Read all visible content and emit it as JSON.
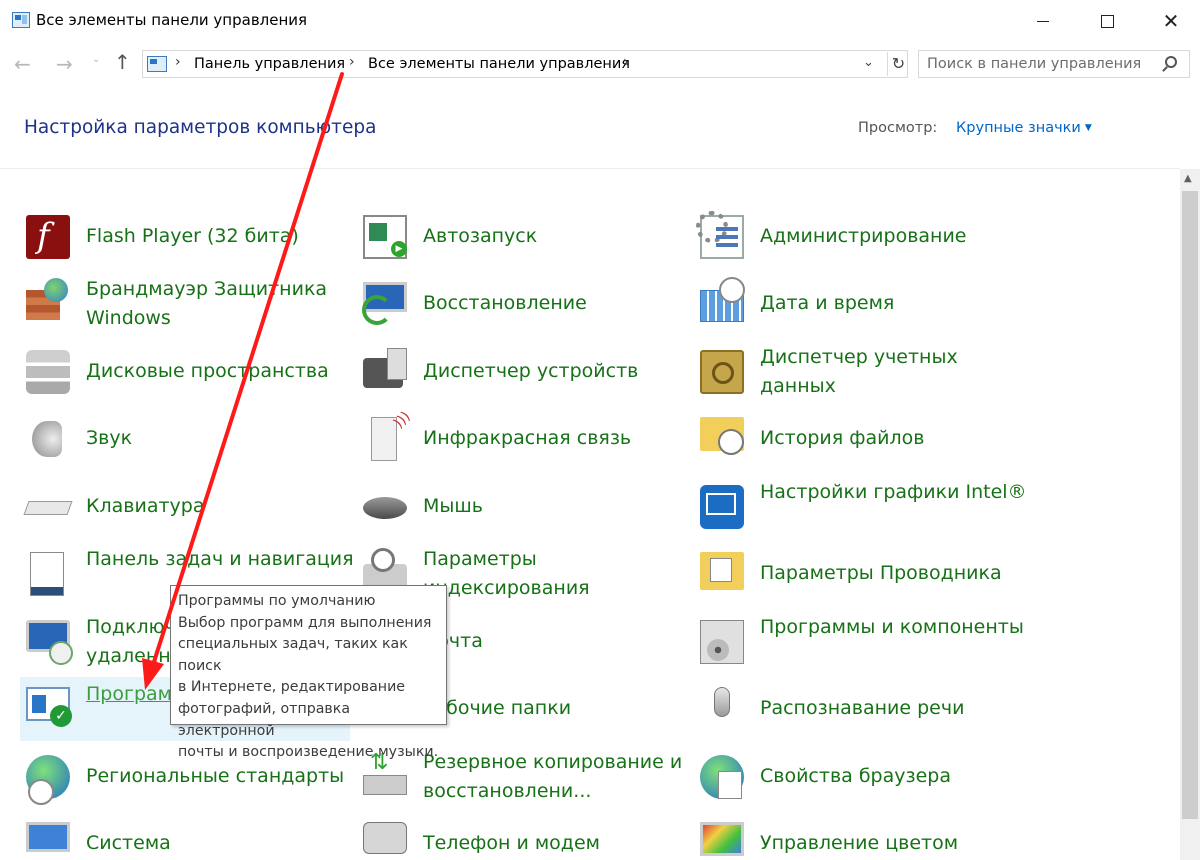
{
  "window": {
    "title": "Все элементы панели управления",
    "minimize": "",
    "maximize": "",
    "close": "✕"
  },
  "nav": {
    "back": "←",
    "forward": "→",
    "recent": "⌄",
    "up": "↑",
    "breadcrumbs": [
      "Панель управления",
      "Все элементы панели управления"
    ],
    "separator": "›",
    "dropdown": "⌄",
    "refresh": "↻"
  },
  "search": {
    "placeholder": "Поиск в панели управления"
  },
  "header": {
    "title": "Настройка параметров компьютера",
    "view_label": "Просмотр:",
    "view_value": "Крупные значки",
    "view_chevron": "▼"
  },
  "columns": [
    [
      {
        "label": "Flash Player (32 бита)",
        "icon": "flash-player-icon"
      },
      {
        "label": "Брандмауэр Защитника Windows",
        "icon": "firewall-icon"
      },
      {
        "label": "Дисковые пространства",
        "icon": "storage-spaces-icon"
      },
      {
        "label": "Звук",
        "icon": "speaker-icon"
      },
      {
        "label": "Клавиатура",
        "icon": "keyboard-icon"
      },
      {
        "label": "Панель задач и навигация",
        "icon": "taskbar-icon"
      },
      {
        "label": "Подключения к удаленным",
        "icon": "remote-desktop-icon"
      },
      {
        "label": "Программы по умолчанию",
        "icon": "default-programs-icon"
      },
      {
        "label": "Региональные стандарты",
        "icon": "region-icon"
      },
      {
        "label": "Система",
        "icon": "system-icon"
      }
    ],
    [
      {
        "label": "Автозапуск",
        "icon": "autoplay-icon"
      },
      {
        "label": "Восстановление",
        "icon": "recovery-icon"
      },
      {
        "label": "Диспетчер устройств",
        "icon": "device-manager-icon"
      },
      {
        "label": "Инфракрасная связь",
        "icon": "infrared-icon"
      },
      {
        "label": "Мышь",
        "icon": "mouse-icon"
      },
      {
        "label": "Параметры индексирования",
        "icon": "indexing-icon"
      },
      {
        "label": "Почта",
        "icon": "mail-icon"
      },
      {
        "label": "Рабочие папки",
        "icon": "work-folders-icon"
      },
      {
        "label": "Резервное копирование и восстановлени...",
        "icon": "backup-icon"
      },
      {
        "label": "Телефон и модем",
        "icon": "phone-modem-icon"
      }
    ],
    [
      {
        "label": "Администрирование",
        "icon": "admin-tools-icon"
      },
      {
        "label": "Дата и время",
        "icon": "date-time-icon"
      },
      {
        "label": "Диспетчер учетных данных",
        "icon": "credential-manager-icon"
      },
      {
        "label": "История файлов",
        "icon": "file-history-icon"
      },
      {
        "label": "Настройки графики Intel®",
        "icon": "intel-graphics-icon"
      },
      {
        "label": "Параметры Проводника",
        "icon": "explorer-options-icon"
      },
      {
        "label": "Программы и компоненты",
        "icon": "programs-features-icon"
      },
      {
        "label": "Распознавание речи",
        "icon": "microphone-icon"
      },
      {
        "label": "Свойства браузера",
        "icon": "internet-options-icon"
      },
      {
        "label": "Управление цветом",
        "icon": "color-management-icon"
      }
    ]
  ],
  "tooltip": {
    "title": "Программы по умолчанию",
    "lines": [
      "Выбор программ для выполнения",
      "специальных задач, таких как поиск",
      "в Интернете, редактирование",
      "фотографий, отправка электронной",
      "почты и воспроизведение музыки."
    ]
  },
  "hovered_item": "Программы по умолчанию",
  "annotation": {
    "type": "arrow",
    "color": "#ff1a1a"
  },
  "colors": {
    "link_green": "#177117",
    "title_blue": "#1e3287",
    "view_blue": "#0066cc",
    "hover_bg": "#e5f3fb"
  }
}
